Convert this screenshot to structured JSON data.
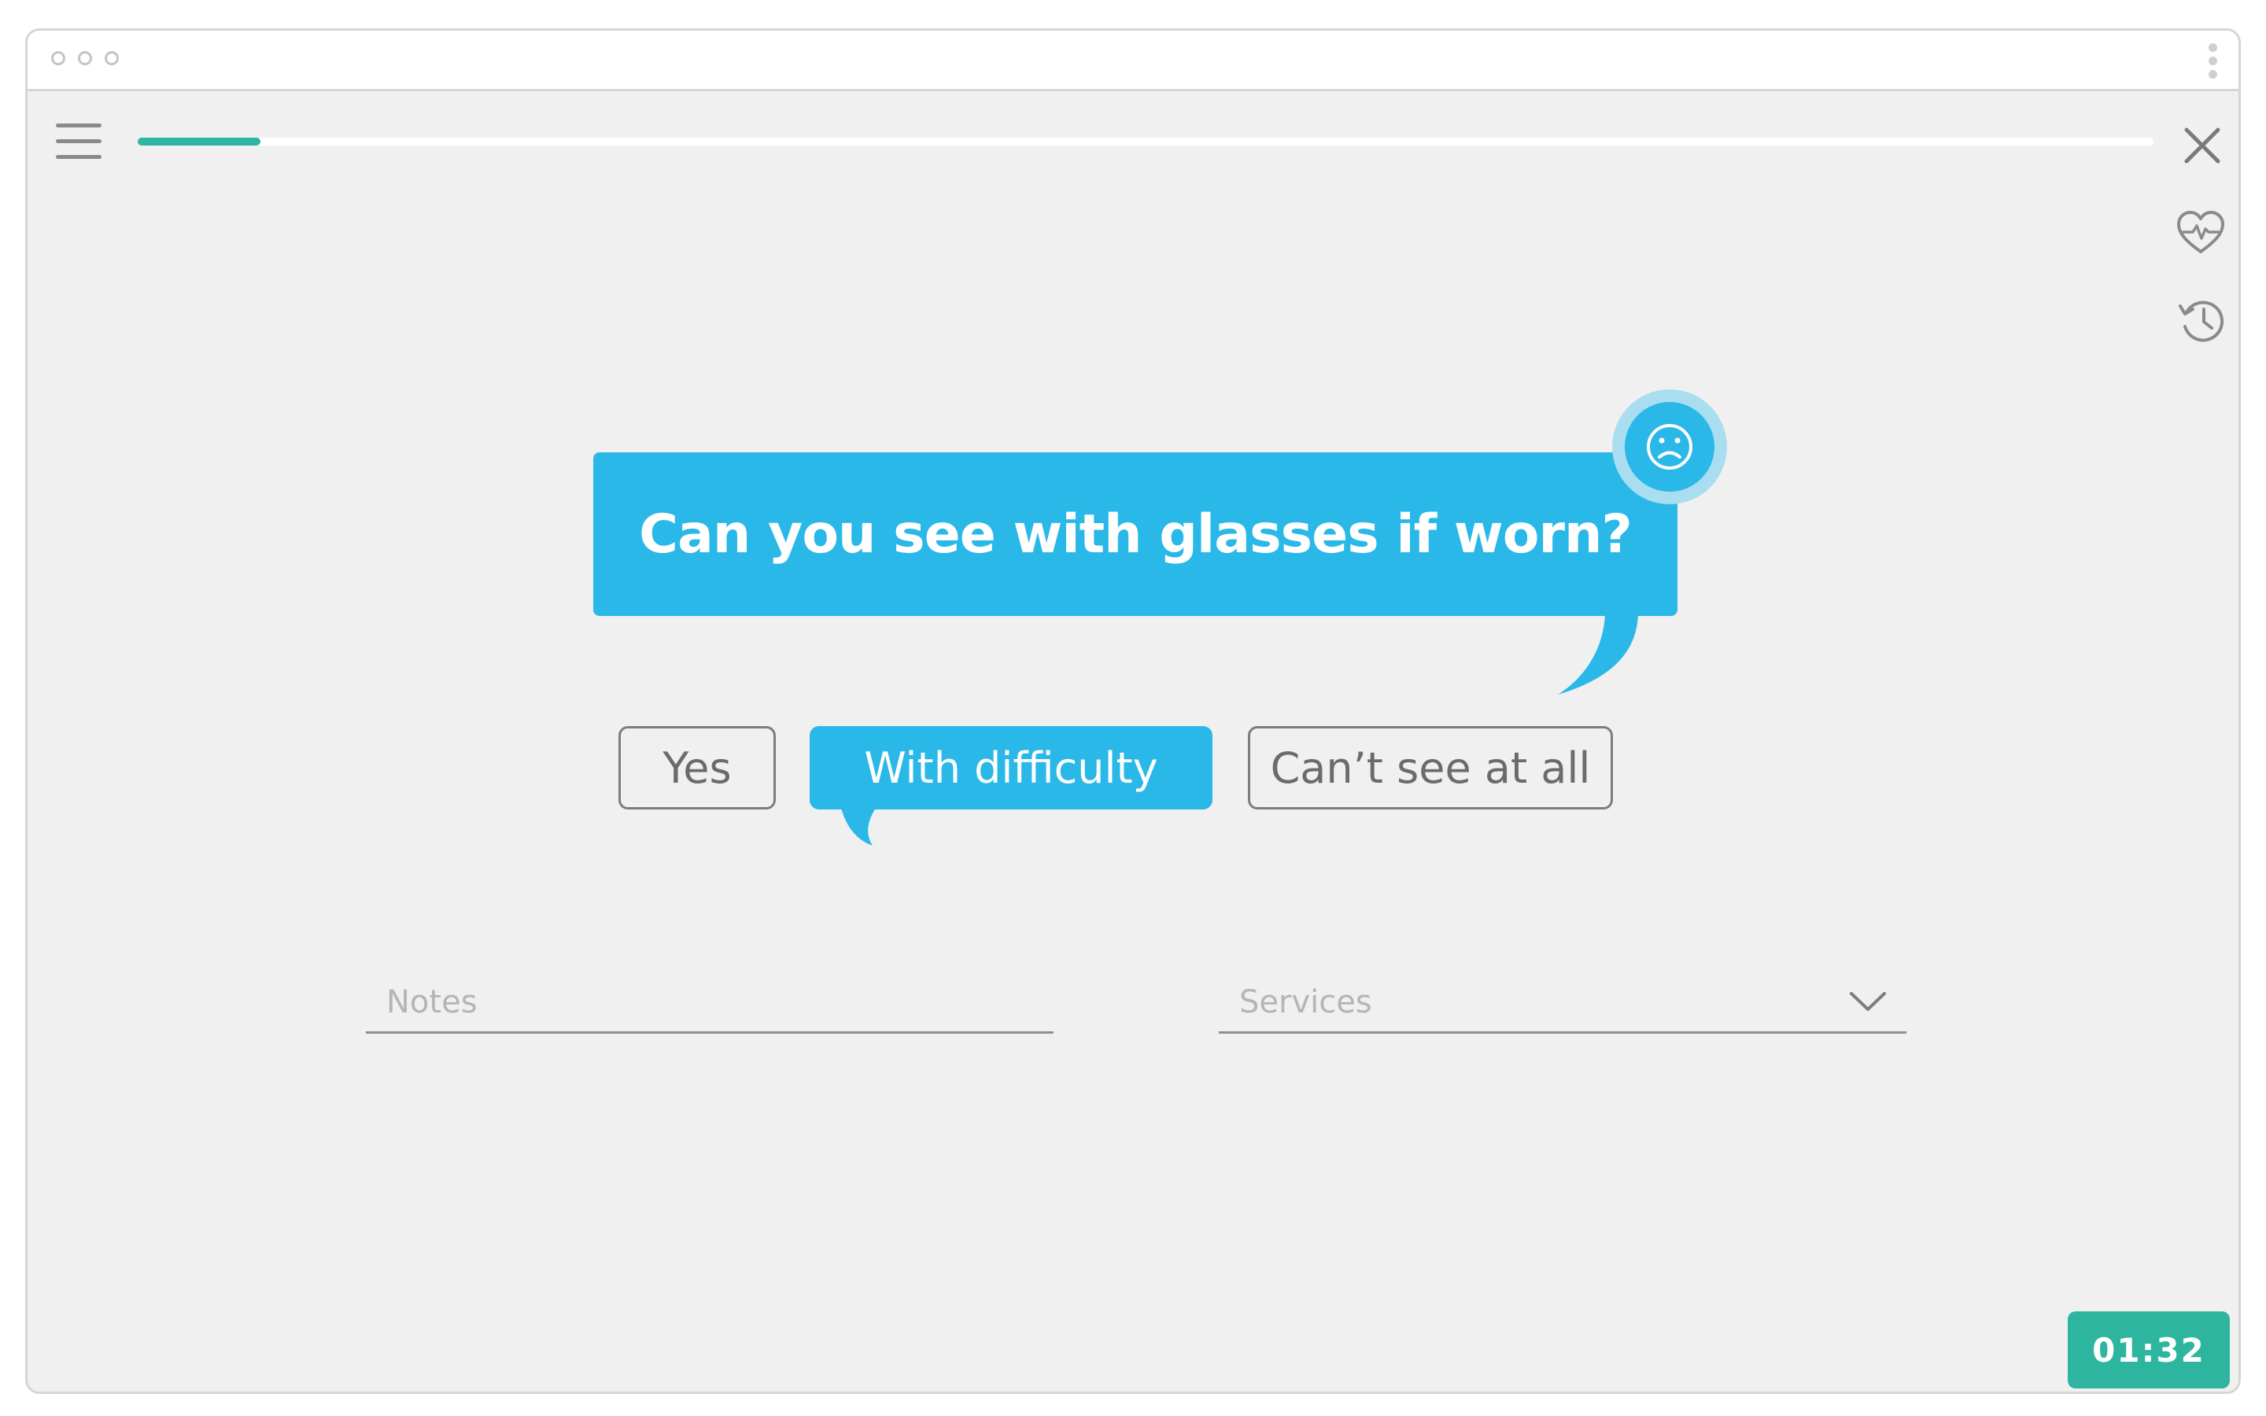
{
  "progress": {
    "value": 0.061
  },
  "question": {
    "text": "Can you see with glasses if worn?",
    "mood_icon": "sad-face-icon"
  },
  "options": [
    {
      "label": "Yes",
      "selected": false
    },
    {
      "label": "With difficulty",
      "selected": true
    },
    {
      "label": "Can’t see at all",
      "selected": false
    }
  ],
  "notes": {
    "placeholder": "Notes"
  },
  "services": {
    "placeholder": "Services"
  },
  "timer": {
    "value": "01:32"
  },
  "colors": {
    "accent_blue": "#29b8e8",
    "accent_teal": "#2db5a0",
    "background": "#f0f0f0"
  },
  "icons": {
    "menu": "hamburger-menu-icon",
    "close": "close-icon",
    "health": "heart-pulse-icon",
    "history": "history-clock-icon",
    "more": "more-vertical-icon",
    "dropdown": "chevron-down-icon"
  }
}
